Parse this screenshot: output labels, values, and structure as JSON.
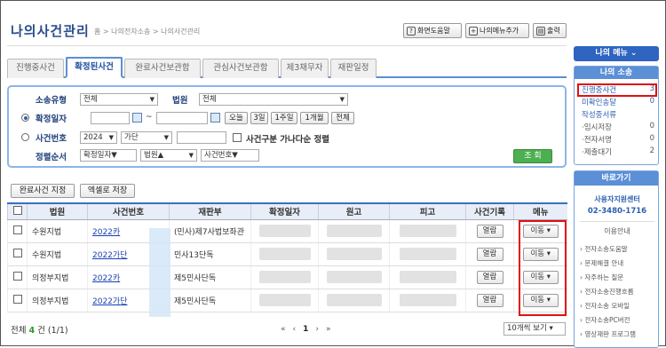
{
  "header": {
    "title": "나의사건관리",
    "breadcrumb": "홈 > 나의전자소송 > 나의사건관리",
    "buttons": [
      {
        "label": "화면도움말",
        "icon": "help-icon"
      },
      {
        "label": "나의메뉴추가",
        "icon": "add-menu-icon"
      },
      {
        "label": "출력",
        "icon": "print-icon"
      }
    ]
  },
  "tabs": [
    "진행중사건",
    "확정된사건",
    "완료사건보관함",
    "관심사건보관함",
    "제3채무자",
    "재판일정"
  ],
  "active_tab": "확정된사건",
  "search": {
    "type_label": "소송유형",
    "type_value": "전체",
    "court_label": "법원",
    "court_value": "전체",
    "date_label": "확정일자",
    "date_sep": "~",
    "date_buttons": [
      "오늘",
      "3일",
      "1주일",
      "1개월",
      "전체"
    ],
    "case_label": "사건번호",
    "case_year": "2024",
    "case_type": "가단",
    "multi_party_label": "사건구분 가나다순 정렬",
    "sort_label": "정렬순서",
    "sort_values": [
      "확정일자▼",
      "법원▲",
      "사건번호▼"
    ],
    "submit": "조 회"
  },
  "actions": {
    "designate_complete": "완료사건 지정",
    "excel_save": "엑셀로 저장"
  },
  "table": {
    "columns": [
      "",
      "법원",
      "사건번호",
      "재판부",
      "확정일자",
      "원고",
      "피고",
      "사건기록",
      "메뉴"
    ],
    "rows": [
      {
        "court": "수원지법",
        "case": "2022카",
        "division": "(민사)제7사법보좌관",
        "record": "열람",
        "menu": "이동 ▾"
      },
      {
        "court": "수원지법",
        "case": "2022가단",
        "division": "민사13단독",
        "record": "열람",
        "menu": "이동 ▾"
      },
      {
        "court": "의정부지법",
        "case": "2022카",
        "division": "제5민사단독",
        "record": "열람",
        "menu": "이동 ▾"
      },
      {
        "court": "의정부지법",
        "case": "2022가단",
        "division": "제5민사단독",
        "record": "열람",
        "menu": "이동 ▾"
      }
    ]
  },
  "footer": {
    "total_prefix": "전체",
    "total_count": "4",
    "total_suffix": "건 (1/1)",
    "pager": [
      "«",
      "‹",
      "1",
      "›",
      "»"
    ],
    "per_page": "10개씩 보기 ▾"
  },
  "sidebar": {
    "my_menu": "나의 메뉴 ⌄",
    "my_lawsuit_title": "나의 소송",
    "stats": [
      {
        "label": "진행중사건",
        "value": "3"
      },
      {
        "label": "미확인송달",
        "value": "0"
      },
      {
        "label": "작성중서류",
        "value": ""
      },
      {
        "label": "·임시저장",
        "value": "0"
      },
      {
        "label": "·전자서명",
        "value": "0"
      },
      {
        "label": "·제출대기",
        "value": "2"
      }
    ],
    "shortcut_title": "바로가기",
    "support_center": "사용자지원센터",
    "support_phone": "02-3480-1716",
    "usage_guide": "이용안내",
    "links": [
      "전자소송도움말",
      "문제해결 안내",
      "자주하는 질문",
      "전자소송진행흐름",
      "전자소송 모바일",
      "전자소송PC버전",
      "영상재판 프로그램"
    ]
  },
  "colors": {
    "accent": "#2f64c0",
    "highlight": "#e01010",
    "submit": "#4caf50"
  }
}
